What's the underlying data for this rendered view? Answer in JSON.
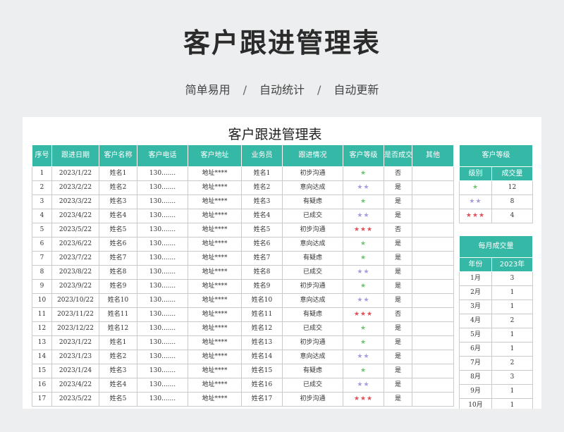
{
  "page": {
    "title": "客户跟进管理表",
    "features": [
      "简单易用",
      "自动统计",
      "自动更新"
    ],
    "separator": "/"
  },
  "sheet": {
    "title": "客户跟进管理表",
    "headers": [
      "序号",
      "跟进日期",
      "客户名称",
      "客户电话",
      "客户地址",
      "业务员",
      "跟进情况",
      "客户等级",
      "是否成交",
      "其他"
    ],
    "rows": [
      [
        "1",
        "2023/1/22",
        "姓名1",
        "130.......",
        "地址****",
        "姓名1",
        "初步沟通",
        1,
        "否",
        ""
      ],
      [
        "2",
        "2023/2/22",
        "姓名2",
        "130.......",
        "地址****",
        "姓名2",
        "意向达成",
        2,
        "是",
        ""
      ],
      [
        "3",
        "2023/3/22",
        "姓名3",
        "130.......",
        "地址****",
        "姓名3",
        "有疑虑",
        1,
        "是",
        ""
      ],
      [
        "4",
        "2023/4/22",
        "姓名4",
        "130.......",
        "地址****",
        "姓名4",
        "已成交",
        2,
        "是",
        ""
      ],
      [
        "5",
        "2023/5/22",
        "姓名5",
        "130.......",
        "地址****",
        "姓名5",
        "初步沟通",
        3,
        "否",
        ""
      ],
      [
        "6",
        "2023/6/22",
        "姓名6",
        "130.......",
        "地址****",
        "姓名6",
        "意向达成",
        1,
        "是",
        ""
      ],
      [
        "7",
        "2023/7/22",
        "姓名7",
        "130.......",
        "地址****",
        "姓名7",
        "有疑虑",
        1,
        "是",
        ""
      ],
      [
        "8",
        "2023/8/22",
        "姓名8",
        "130.......",
        "地址****",
        "姓名8",
        "已成交",
        2,
        "是",
        ""
      ],
      [
        "9",
        "2023/9/22",
        "姓名9",
        "130.......",
        "地址****",
        "姓名9",
        "初步沟通",
        1,
        "是",
        ""
      ],
      [
        "10",
        "2023/10/22",
        "姓名10",
        "130.......",
        "地址****",
        "姓名10",
        "意向达成",
        2,
        "是",
        ""
      ],
      [
        "11",
        "2023/11/22",
        "姓名11",
        "130.......",
        "地址****",
        "姓名11",
        "有疑虑",
        3,
        "否",
        ""
      ],
      [
        "12",
        "2023/12/22",
        "姓名12",
        "130.......",
        "地址****",
        "姓名12",
        "已成交",
        1,
        "是",
        ""
      ],
      [
        "13",
        "2023/1/22",
        "姓名1",
        "130.......",
        "地址****",
        "姓名13",
        "初步沟通",
        1,
        "是",
        ""
      ],
      [
        "14",
        "2023/1/23",
        "姓名2",
        "130.......",
        "地址****",
        "姓名14",
        "意向达成",
        2,
        "是",
        ""
      ],
      [
        "15",
        "2023/1/24",
        "姓名3",
        "130.......",
        "地址****",
        "姓名15",
        "有疑虑",
        1,
        "是",
        ""
      ],
      [
        "16",
        "2023/4/22",
        "姓名4",
        "130.......",
        "地址****",
        "姓名16",
        "已成交",
        2,
        "是",
        ""
      ],
      [
        "17",
        "2023/5/22",
        "姓名5",
        "130.......",
        "地址****",
        "姓名17",
        "初步沟通",
        3,
        "是",
        ""
      ]
    ]
  },
  "levels": {
    "title": "客户等级",
    "headers": [
      "级别",
      "成交量"
    ],
    "rows": [
      {
        "stars": 1,
        "count": "12"
      },
      {
        "stars": 2,
        "count": "8"
      },
      {
        "stars": 3,
        "count": "4"
      }
    ]
  },
  "monthly": {
    "title": "每月成交量",
    "headers": [
      "年份",
      "2023年"
    ],
    "rows": [
      [
        "1月",
        "3"
      ],
      [
        "2月",
        "1"
      ],
      [
        "3月",
        "1"
      ],
      [
        "4月",
        "2"
      ],
      [
        "5月",
        "1"
      ],
      [
        "6月",
        "1"
      ],
      [
        "7月",
        "2"
      ],
      [
        "8月",
        "3"
      ],
      [
        "9月",
        "1"
      ],
      [
        "10月",
        "1"
      ]
    ]
  },
  "icons": {
    "star": "★"
  },
  "colors": {
    "header": "#35b8a6",
    "star_1": "#72c472",
    "star_2": "#a89cd8",
    "star_3": "#e0505a"
  }
}
